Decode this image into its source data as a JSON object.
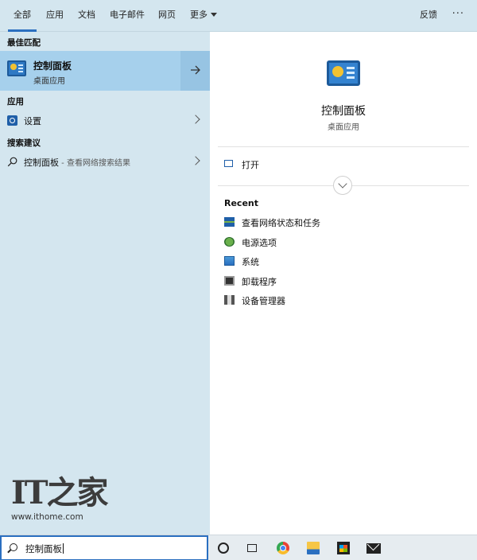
{
  "tabs": [
    {
      "label": "全部",
      "active": true
    },
    {
      "label": "应用"
    },
    {
      "label": "文档"
    },
    {
      "label": "电子邮件"
    },
    {
      "label": "网页"
    },
    {
      "label": "更多"
    }
  ],
  "header": {
    "feedback_label": "反馈",
    "more_options": "···"
  },
  "best_match": {
    "section_label": "最佳匹配",
    "title": "控制面板",
    "subtitle": "桌面应用"
  },
  "apps": {
    "section_label": "应用",
    "items": [
      {
        "label": "设置",
        "icon": "gear-icon"
      }
    ]
  },
  "suggestions": {
    "section_label": "搜索建议",
    "items": [
      {
        "label": "控制面板",
        "sub": " - 查看网络搜索结果"
      }
    ]
  },
  "watermark": {
    "logo": "IT之家",
    "url": "www.ithome.com"
  },
  "detail": {
    "title": "控制面板",
    "subtitle": "桌面应用",
    "open_label": "打开",
    "recent_label": "Recent",
    "recent_items": [
      {
        "label": "查看网络状态和任务",
        "icon": "network-icon"
      },
      {
        "label": "电源选项",
        "icon": "power-icon"
      },
      {
        "label": "系统",
        "icon": "system-icon"
      },
      {
        "label": "卸载程序",
        "icon": "programs-icon"
      },
      {
        "label": "设备管理器",
        "icon": "device-manager-icon"
      }
    ]
  },
  "search": {
    "value": "控制面板"
  },
  "colors": {
    "accent": "#2a6fc0",
    "pane_bg": "#d4e6ef",
    "selected": "#a6d0ec"
  }
}
